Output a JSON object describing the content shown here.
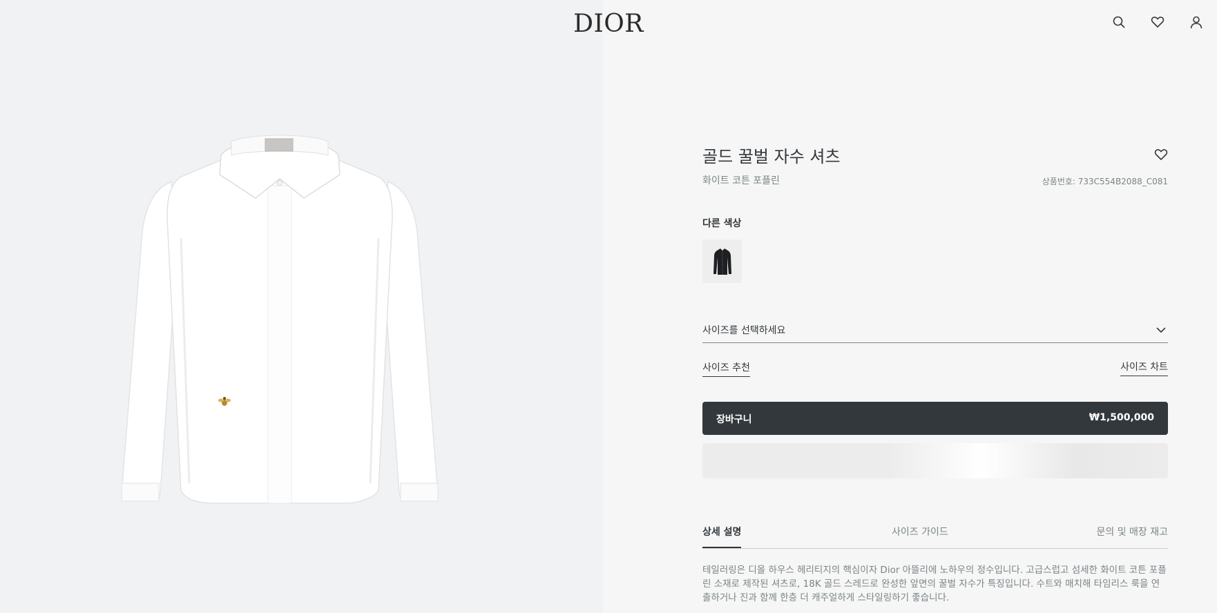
{
  "header": {
    "logo": "DIOR",
    "icons": [
      "search-icon",
      "heart-icon",
      "user-icon"
    ]
  },
  "product": {
    "title": "골드 꿀벌 자수 셔츠",
    "subtitle": "화이트 코튼 포플린",
    "reference": "상품번호: 733C554B2088_C081",
    "other_colors_label": "다른 색상",
    "size_select_placeholder": "사이즈를 선택하세요",
    "size_recommend_link": "사이즈 추천",
    "size_chart_link": "사이즈 차트",
    "cart": {
      "label": "장바구니",
      "price": "₩1,500,000"
    },
    "tabs": [
      {
        "label": "상세 설명",
        "active": true
      },
      {
        "label": "사이즈 가이드",
        "active": false
      },
      {
        "label": "문의 및 매장 재고",
        "active": false
      }
    ],
    "description": "테일러링은 디올 하우스 헤리티지의 핵심이자 Dior 아뜰리에 노하우의 정수입니다. 고급스럽고 섬세한 화이트 코튼 포플린 소재로 제작된 셔츠로, 18K 골드 스레드로 완성한 앞면의 꿀벌 자수가 특징입니다. 수트와 매치해 타임리스 룩을 연출하거나 진과 함께 한층 더 캐주얼하게 스타일링하기 좋습니다."
  },
  "colors": {
    "button_dark": "#33383c",
    "text_muted": "#7b8487",
    "left_bg": "#f1f2f4",
    "right_bg": "#f6f6f6",
    "bee_gold": "#b8892f"
  }
}
